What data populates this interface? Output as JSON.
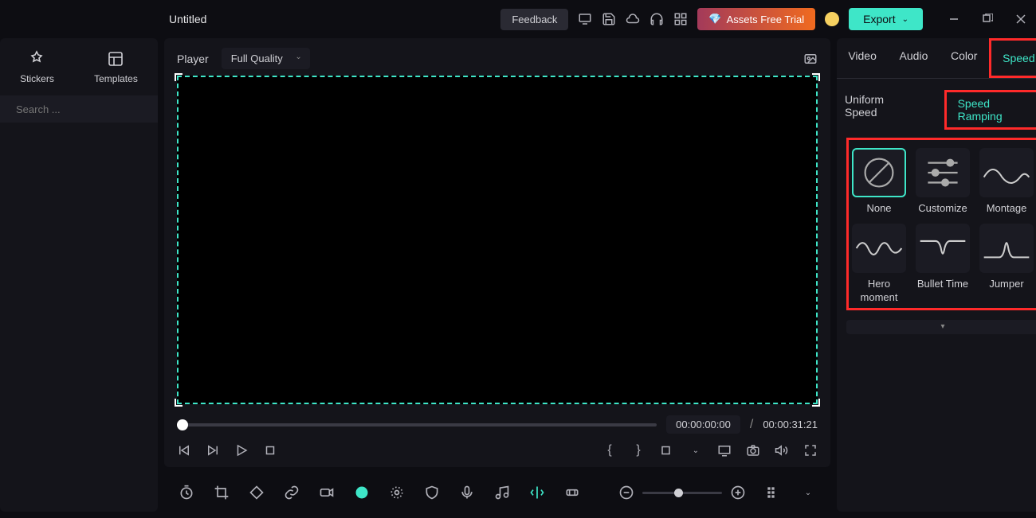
{
  "title": "Untitled",
  "topbar": {
    "feedback": "Feedback",
    "trial": "Assets Free Trial",
    "export": "Export"
  },
  "sidebar": {
    "stickers": "Stickers",
    "templates": "Templates",
    "search_placeholder": "Search ..."
  },
  "player": {
    "label": "Player",
    "quality": "Full Quality",
    "current_time": "00:00:00:00",
    "sep": "/",
    "total_time": "00:00:31:21"
  },
  "rtabs": {
    "video": "Video",
    "audio": "Audio",
    "color": "Color",
    "speed": "Speed"
  },
  "subtabs": {
    "uniform": "Uniform Speed",
    "ramping": "Speed Ramping"
  },
  "presets": [
    {
      "label": "None"
    },
    {
      "label": "Customize"
    },
    {
      "label": "Montage"
    },
    {
      "label": "Hero moment"
    },
    {
      "label": "Bullet Time"
    },
    {
      "label": "Jumper"
    }
  ]
}
